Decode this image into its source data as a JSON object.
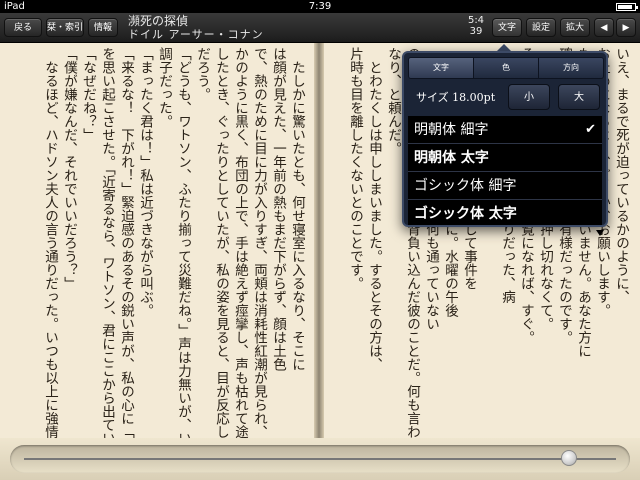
{
  "status": {
    "carrier": "iPad",
    "time": "7:39",
    "battery_level": 0.85
  },
  "toolbar": {
    "back_label": "戻る",
    "bookmarks_label": "栞・索引",
    "info_label": "情報",
    "title": "瀕死の探偵",
    "author": "ドイル アーサー・コナン",
    "page_current": "5:4",
    "page_total": "39",
    "text_label": "文字",
    "settings_label": "設定",
    "zoom_label": "拡大",
    "prev_icon": "◀",
    "next_icon": "▶"
  },
  "pages": {
    "left_lines": [
      "　たしかに驚いたとも、何せ寝室に入るなり、そこに",
      "は顔が見えた、一年前の熱もまだ下がらず、顔は土色",
      "で、熱のために目に力が入りすぎ、両頬は消耗性紅潮が見られ、唇は変色した",
      "かのように黒く、布団の上で、手は絶えず痙攣し、声も枯れて途切れ途切れだった。私が入室",
      "したとき、ぐったりとしていたが、私の姿を見ると、目が反応したので、気づいていたの",
      "だろう。",
      "「どうも、ワトソン、ふたり揃って災難だね。」声は力無いが、いつもの通りの",
      "調子だった。",
      "「まったく君は！」私は近づきながら叫ぶ。",
      "「来るな！　下がれ！」緊迫感のあるその鋭い声が、私の心に「危篤」の二文字",
      "を思い起こさせた。「近寄るなら、ワトソン、君にここから出ていってもらう。」",
      "「なぜだね？」",
      "「僕が嫌なんだ、それでいいだろう？」",
      "　なるほど、ハドソン夫人の言う通りだった。いつも以上に強情だ。とはいえ、"
    ],
    "right_lines": [
      "いえ、まるで死が迫っているかのように、",
      "お止めになるよう、どうか、お願いします。",
      "も、もうよくなるわけがございません。あなた方に",
      "確かに本人は、見るも無惨な有様だったのです。",
      "　強情でしょう？　ですから押し切れなくて。",
      "そうです、わかりますね、ご覧になれば、すぐ。",
      "　霧深い十一月の日の薄明かりだった、病",
      "　　　　　　　　　　　　　　　　　　　　",
      "　ちょうどロザハイズに出向して事件を",
      "　からこの病気をお持ち帰りに。水曜の午後",
      "　なり、この三日間は、喉に何も通っていない",
      "の依頼を受け、大変なものを背負い込んだ彼のことだ。何も言わず外套と帽子を",
      "なり、と頼んだ。",
      "　とわたくしは申ししまいました。するとその方は、",
      "片時も目を離したくないとのことです。"
    ]
  },
  "popover": {
    "tabs": [
      "文字",
      "色",
      "方向"
    ],
    "selected_tab": 0,
    "size_label": "サイズ 18.00pt",
    "small_label": "小",
    "large_label": "大",
    "fonts": [
      {
        "label": "明朝体 細字",
        "checked": true
      },
      {
        "label": "明朝体 太字",
        "checked": false
      },
      {
        "label": "ゴシック体 細字",
        "checked": false
      },
      {
        "label": "ゴシック体 太字",
        "checked": false
      }
    ],
    "check_icon": "✔"
  },
  "slider": {
    "value": 0.92
  }
}
